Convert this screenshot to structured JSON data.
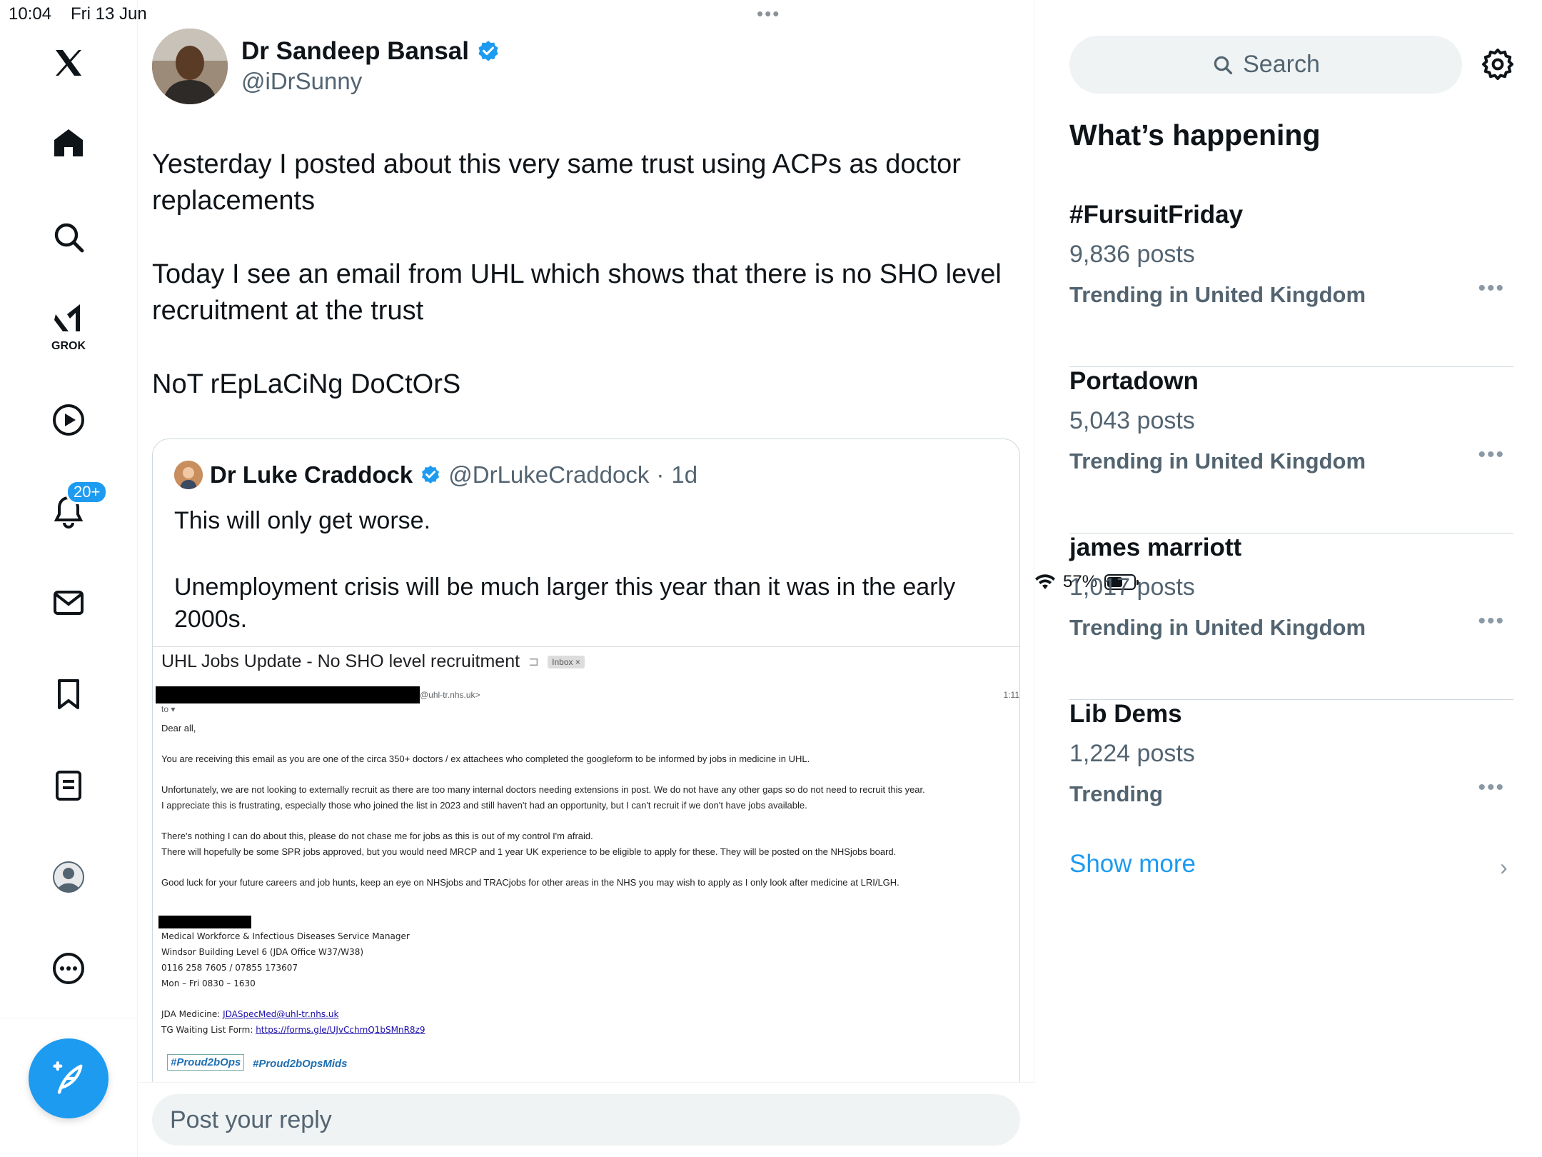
{
  "status_bar": {
    "time": "10:04",
    "date": "Fri 13 Jun",
    "battery_percent": "57%",
    "battery_level": 0.57
  },
  "nav": {
    "grok_label": "GROK",
    "notifications_badge": "20+"
  },
  "tweet": {
    "author_name": "Dr Sandeep Bansal",
    "author_handle": "@iDrSunny",
    "paragraphs": [
      "Yesterday I posted about this very same trust using ACPs as doctor replacements",
      "Today I see an email from UHL which shows that there is no SHO level recruitment at the trust",
      "NoT rEpLaCiNg DoCtOrS"
    ]
  },
  "quote": {
    "author_name": "Dr Luke Craddock",
    "author_handle": "@DrLukeCraddock",
    "time_ago": "1d",
    "separator": "·",
    "paragraphs": [
      "This will only get worse.",
      "Unemployment crisis will be much larger this year than it was in the early 2000s."
    ]
  },
  "email": {
    "subject": "UHL Jobs Update - No SHO level recruitment",
    "inbox_chip": "Inbox ×",
    "from_domain": "@uhl-tr.nhs.uk>",
    "time": "1:11",
    "to": "to ▾",
    "greeting": "Dear all,",
    "body": [
      "You are receiving this email as you are one of the circa 350+ doctors / ex attachees who completed the googleform to be informed by jobs in medicine in UHL.",
      "Unfortunately, we are not looking to externally recruit as there are too many internal doctors needing extensions in post. We do not have any other gaps so do not need to recruit this year.",
      "I appreciate this is frustrating, especially those who joined the list in 2023 and still haven't had an opportunity, but I can't recruit if we don't have jobs available.",
      "There's nothing I can do about this, please do not chase me for jobs as this is out of my control I'm afraid.",
      "There will hopefully be some SPR jobs approved, but you would need MRCP and 1 year UK experience to be eligible to apply for these. They will be posted on the NHSjobs board.",
      "Good luck for your future careers and job hunts, keep an eye on NHSjobs and TRACjobs for other areas in the NHS you may wish to apply as I only look after medicine at LRI/LGH."
    ],
    "signature": {
      "role": "Medical Workforce & Infectious Diseases Service Manager",
      "building": "Windsor Building Level 6 (JDA Office W37/W38)",
      "phone": "0116 258 7605 / 07855 173607",
      "hours": "Mon – Fri 0830 – 1630",
      "jda_label": "JDA Medicine: ",
      "jda_email": "JDASpecMed@uhl-tr.nhs.uk",
      "tg_label": "TG Waiting List Form: ",
      "tg_link": "https://forms.gle/UJvCchmQ1bSMnR8z9"
    },
    "logo_left": "#Proud2bOps",
    "logo_right": "#Proud2bOpsMids"
  },
  "reply": {
    "placeholder": "Post your reply"
  },
  "sidebar": {
    "search_label": "Search",
    "title": "What’s happening",
    "trends": [
      {
        "name": "#FursuitFriday",
        "posts": "9,836 posts",
        "context": "Trending in United Kingdom"
      },
      {
        "name": "Portadown",
        "posts": "5,043 posts",
        "context": "Trending in United Kingdom"
      },
      {
        "name": "james marriott",
        "posts": "1,017 posts",
        "context": "Trending in United Kingdom"
      },
      {
        "name": "Lib Dems",
        "posts": "1,224 posts",
        "context": "Trending"
      }
    ],
    "more_glyph": "•••",
    "show_more": "Show more"
  },
  "colors": {
    "accent": "#1d9bf0",
    "text": "#0f1419",
    "secondary_text": "#536471",
    "border": "#eff3f4"
  },
  "icons": [
    "x-logo-icon",
    "home-icon",
    "explore-icon",
    "grok-icon",
    "video-icon",
    "notifications-icon",
    "messages-icon",
    "bookmarks-icon",
    "lists-icon",
    "profile-icon",
    "more-icon",
    "compose-icon",
    "verified-icon",
    "search-icon",
    "settings-icon",
    "chevron-right-icon",
    "wifi-icon",
    "battery-icon"
  ]
}
